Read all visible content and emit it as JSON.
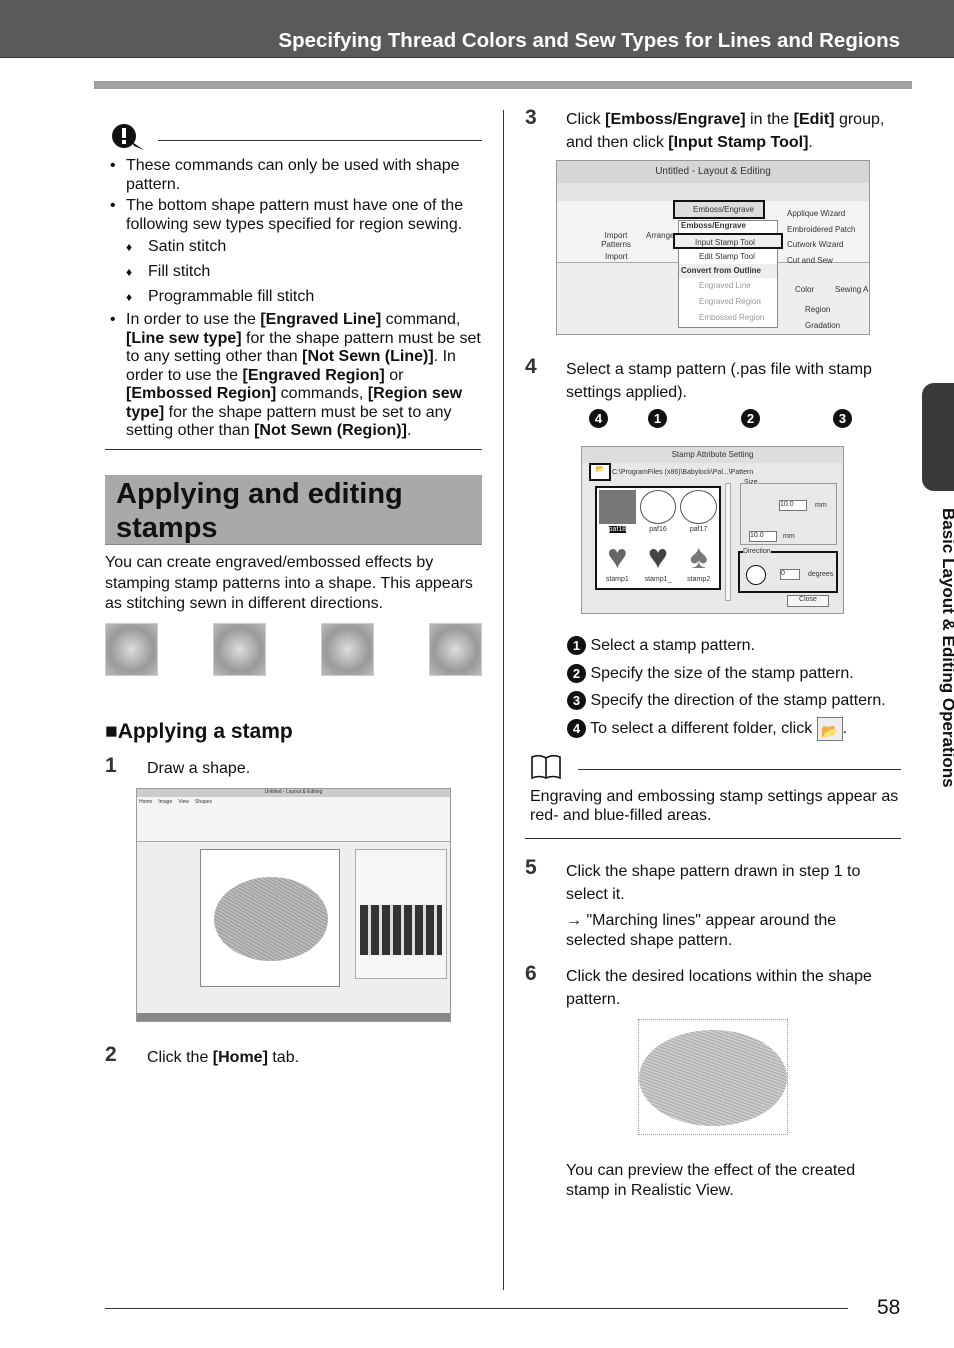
{
  "header": {
    "title": "Specifying Thread Colors and Sew Types for Lines and Regions"
  },
  "note": {
    "icon": "exclamation-note-icon",
    "bullets": [
      "These commands can only be used with shape pattern.",
      "The bottom shape pattern must have one of the following sew types specified for region sewing."
    ],
    "sew_types": [
      "Satin stitch",
      "Fill stitch",
      "Programmable fill stitch"
    ],
    "bullet3": {
      "a": "In order to use the ",
      "b": "[Engraved Line]",
      "c": " command, ",
      "d": "[Line sew type]",
      "e": " for the shape pattern must be set to any setting other than ",
      "f": "[Not Sewn (Line)]",
      "g": ". In order to use the ",
      "h": "[Engraved Region]",
      "i": " or ",
      "j": "[Embossed Region]",
      "k": " commands, ",
      "l": "[Region sew type]",
      "m": " for the shape pattern must be set to any setting other than ",
      "n": "[Not Sewn (Region)]",
      "o": "."
    }
  },
  "section": {
    "title": "Applying and editing stamps",
    "intro": "You can create engraved/embossed effects by stamping stamp patterns into a shape. This appears as stitching sewn in different directions."
  },
  "subsection": {
    "title": "Applying a stamp",
    "marker": "■"
  },
  "steps": {
    "s1": {
      "num": "1",
      "text": "Draw a shape."
    },
    "s2": {
      "num": "2",
      "a": "Click the ",
      "b": "[Home]",
      "c": " tab."
    },
    "s3": {
      "num": "3",
      "a": "Click ",
      "b": "[Emboss/Engrave]",
      "c": " in the ",
      "d": "[Edit]",
      "e": " group, and then click ",
      "f": "[Input Stamp Tool]",
      "g": "."
    },
    "s4": {
      "num": "4",
      "text": "Select a stamp pattern (.pas file with stamp settings applied)."
    },
    "s5": {
      "num": "5",
      "text": "Click the shape pattern drawn in step 1 to select it.",
      "result": "\"Marching lines\" appear around the selected shape pattern.",
      "arrow": "→"
    },
    "s6": {
      "num": "6",
      "text": "Click the desired locations within the shape pattern.",
      "after": "You can preview the effect of the created stamp in Realistic View."
    }
  },
  "callouts": [
    {
      "n": "1",
      "text": "Select a stamp pattern."
    },
    {
      "n": "2",
      "text": "Specify the size of the stamp pattern."
    },
    {
      "n": "3",
      "text": "Specify the direction of the stamp pattern."
    },
    {
      "n": "4",
      "text": "To select a different folder, click"
    }
  ],
  "memo": {
    "icon": "memo-book-icon",
    "text": "Engraving and embossing stamp settings appear as red- and blue-filled areas."
  },
  "shot1": {
    "title": "Untitled - Layout & Editing",
    "tabs": [
      "Home",
      "Image",
      "View",
      "Shapes"
    ]
  },
  "shot3": {
    "title": "Untitled - Layout & Editing",
    "button": "Emboss/Engrave",
    "menu_header": "Emboss/Engrave",
    "items": [
      "Input Stamp Tool",
      "Edit Stamp Tool"
    ],
    "convert_header": "Convert from Outline",
    "disabled": [
      "Engraved Line",
      "Engraved Region",
      "Embossed Region"
    ],
    "right": [
      "Applique Wizard",
      "Embroidered Patch",
      "Cutwork Wizard",
      "Cut and Sew"
    ],
    "import": "Import Patterns",
    "import_group": "Import",
    "arrange": "Arrange",
    "color": "Color",
    "sewing": "Sewing A",
    "region": "Region",
    "gradation": "Gradation"
  },
  "shot4": {
    "title": "Stamp Attribute Setting",
    "path": "C:\\ProgramFiles (x86)\\Babylock\\Pal...\\Pattern",
    "stamps": [
      "paf18",
      "paf16",
      "paf17",
      "stamp1",
      "stamp1_",
      "stamp2"
    ],
    "size_label": "Size",
    "size_w": "10.0",
    "size_h": "10.0",
    "unit": "mm",
    "direction_label": "Direction",
    "direction": "0",
    "degrees": "degrees",
    "close": "Close"
  },
  "sidetab": {
    "text": "Basic Layout & Editing Operations"
  },
  "footer": {
    "page": "58"
  }
}
